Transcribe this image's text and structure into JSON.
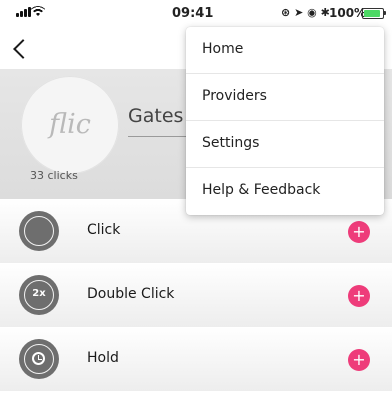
{
  "status_bar": {
    "time": "09:41",
    "battery_percent": "100%",
    "battery_level": 1.0,
    "icons": [
      "signal-icon",
      "wifi-icon",
      "lock-rotation-icon",
      "location-icon",
      "alarm-icon",
      "bluetooth-icon",
      "battery-icon",
      "charging-icon"
    ]
  },
  "nav": {
    "back_icon": "chevron-left-icon"
  },
  "header": {
    "logo_text": "flic",
    "click_count": "33 clicks",
    "button_name": "Gates"
  },
  "actions": [
    {
      "label": "Click",
      "icon": "single-press-icon",
      "icon_text": ""
    },
    {
      "label": "Double Click",
      "icon": "double-press-icon",
      "icon_text": "2x"
    },
    {
      "label": "Hold",
      "icon": "clock-icon",
      "icon_text": ""
    }
  ],
  "add_label": "+",
  "menu": {
    "items": [
      {
        "label": "Home"
      },
      {
        "label": "Providers"
      },
      {
        "label": "Settings"
      },
      {
        "label": "Help & Feedback"
      }
    ]
  },
  "colors": {
    "accent": "#ee3c7a",
    "icon_gray": "#6e6e6e",
    "header_bg": "#e0e0e0",
    "battery_green": "#4cd964"
  }
}
